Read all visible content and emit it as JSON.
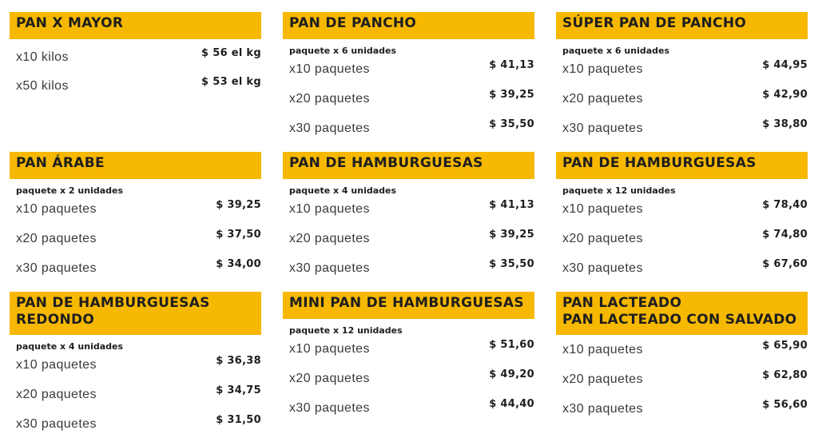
{
  "cards": [
    {
      "title": [
        "PAN X MAYOR"
      ],
      "subtitle": "",
      "rows": [
        {
          "qty": "x10 kilos",
          "price": "$ 56 el kg"
        },
        {
          "qty": "x50 kilos",
          "price": "$ 53 el kg"
        }
      ]
    },
    {
      "title": [
        "PAN DE PANCHO"
      ],
      "subtitle": "paquete x 6 unidades",
      "rows": [
        {
          "qty": "x10 paquetes",
          "price": "$ 41,13"
        },
        {
          "qty": "x20 paquetes",
          "price": "$ 39,25"
        },
        {
          "qty": "x30 paquetes",
          "price": "$ 35,50"
        }
      ]
    },
    {
      "title": [
        "SÚPER PAN DE PANCHO"
      ],
      "subtitle": "paquete x 6 unidades",
      "rows": [
        {
          "qty": "x10 paquetes",
          "price": "$ 44,95"
        },
        {
          "qty": "x20 paquetes",
          "price": "$ 42,90"
        },
        {
          "qty": "x30 paquetes",
          "price": "$ 38,80"
        }
      ]
    },
    {
      "title": [
        "PAN ÁRABE"
      ],
      "subtitle": "paquete x 2 unidades",
      "rows": [
        {
          "qty": "x10 paquetes",
          "price": "$ 39,25"
        },
        {
          "qty": "x20 paquetes",
          "price": "$ 37,50"
        },
        {
          "qty": "x30 paquetes",
          "price": "$ 34,00"
        }
      ]
    },
    {
      "title": [
        "PAN DE HAMBURGUESAS"
      ],
      "subtitle": "paquete x 4 unidades",
      "rows": [
        {
          "qty": "x10 paquetes",
          "price": "$ 41,13"
        },
        {
          "qty": "x20 paquetes",
          "price": "$ 39,25"
        },
        {
          "qty": "x30 paquetes",
          "price": "$ 35,50"
        }
      ]
    },
    {
      "title": [
        "PAN DE HAMBURGUESAS"
      ],
      "subtitle": "paquete x 12 unidades",
      "rows": [
        {
          "qty": "x10 paquetes",
          "price": "$ 78,40"
        },
        {
          "qty": "x20 paquetes",
          "price": "$ 74,80"
        },
        {
          "qty": "x30 paquetes",
          "price": "$ 67,60"
        }
      ]
    },
    {
      "title": [
        "PAN DE HAMBURGUESAS",
        "REDONDO"
      ],
      "subtitle": "paquete x 4 unidades",
      "rows": [
        {
          "qty": "x10 paquetes",
          "price": "$ 36,38"
        },
        {
          "qty": "x20 paquetes",
          "price": "$ 34,75"
        },
        {
          "qty": "x30 paquetes",
          "price": "$ 31,50"
        }
      ]
    },
    {
      "title": [
        "MINI PAN DE HAMBURGUESAS"
      ],
      "subtitle": "paquete x 12 unidades",
      "rows": [
        {
          "qty": "x10 paquetes",
          "price": "$ 51,60"
        },
        {
          "qty": "x20 paquetes",
          "price": "$ 49,20"
        },
        {
          "qty": "x30 paquetes",
          "price": "$ 44,40"
        }
      ]
    },
    {
      "title": [
        "PAN LACTEADO",
        "PAN LACTEADO CON SALVADO"
      ],
      "subtitle": "",
      "rows": [
        {
          "qty": "x10 paquetes",
          "price": "$ 65,90"
        },
        {
          "qty": "x20 paquetes",
          "price": "$ 62,80"
        },
        {
          "qty": "x30 paquetes",
          "price": "$ 56,60"
        }
      ]
    }
  ],
  "colors": {
    "header_bg": "#f6b800",
    "text": "#1e1e1e"
  }
}
